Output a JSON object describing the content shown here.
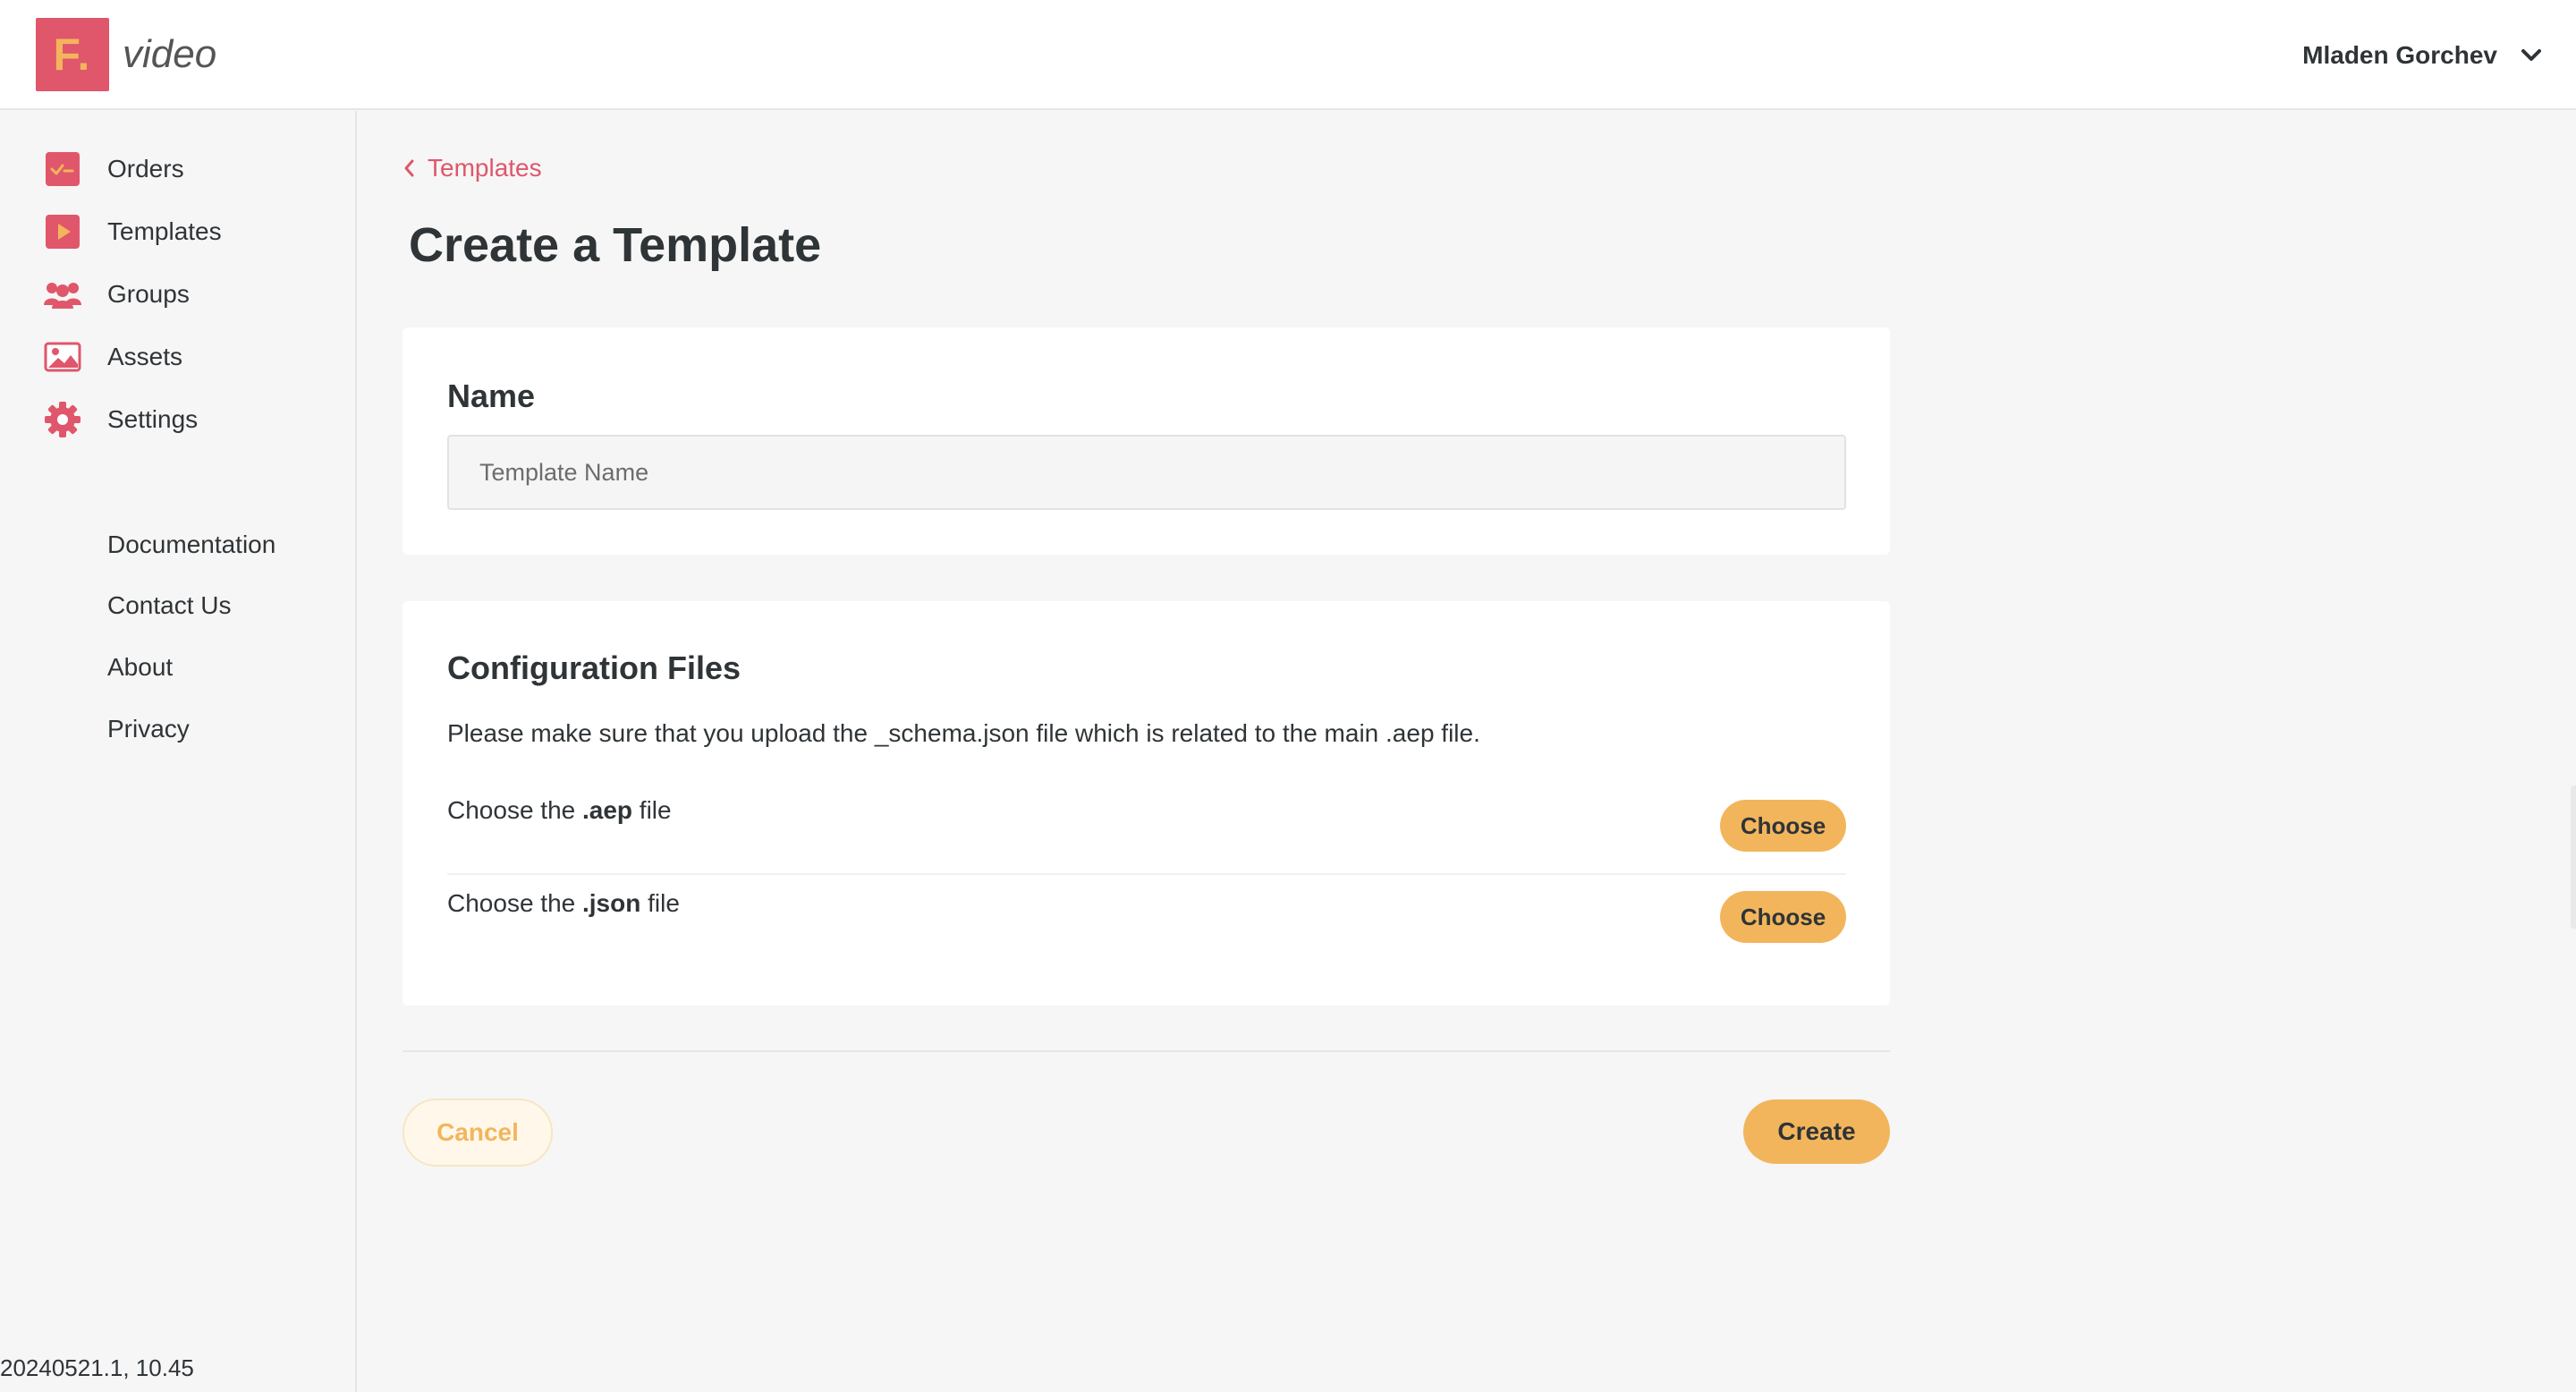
{
  "header": {
    "logo_letter": "F.",
    "logo_text": "video",
    "user_name": "Mladen Gorchev",
    "brand_color": "#e0566b",
    "accent_color": "#f3b55c"
  },
  "sidebar": {
    "items": [
      {
        "label": "Orders",
        "icon": "orders-icon"
      },
      {
        "label": "Templates",
        "icon": "play-icon"
      },
      {
        "label": "Groups",
        "icon": "users-icon"
      },
      {
        "label": "Assets",
        "icon": "image-icon"
      },
      {
        "label": "Settings",
        "icon": "gear-icon"
      }
    ],
    "links": [
      "Documentation",
      "Contact Us",
      "About",
      "Privacy"
    ],
    "version": "20240521.1, 10.45"
  },
  "breadcrumb": {
    "label": "Templates"
  },
  "page": {
    "title": "Create a Template",
    "name_section": {
      "heading": "Name",
      "placeholder": "Template Name",
      "value": ""
    },
    "config_section": {
      "heading": "Configuration Files",
      "description": "Please make sure that you upload the _schema.json file which is related to the main .aep file.",
      "files": [
        {
          "prefix": "Choose the ",
          "ext": ".aep",
          "suffix": " file",
          "button": "Choose"
        },
        {
          "prefix": "Choose the ",
          "ext": ".json",
          "suffix": " file",
          "button": "Choose"
        }
      ]
    },
    "actions": {
      "cancel": "Cancel",
      "create": "Create"
    }
  }
}
